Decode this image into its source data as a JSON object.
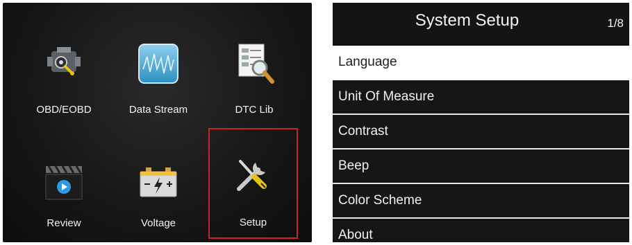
{
  "main_menu": {
    "items": [
      {
        "label": "OBD/EOBD",
        "icon": "engine-icon"
      },
      {
        "label": "Data Stream",
        "icon": "data-stream-icon"
      },
      {
        "label": "DTC Lib",
        "icon": "dtc-lib-icon"
      },
      {
        "label": "Review",
        "icon": "review-icon"
      },
      {
        "label": "Voltage",
        "icon": "battery-icon"
      },
      {
        "label": "Setup",
        "icon": "wrench-screwdriver-icon",
        "highlighted": true
      }
    ],
    "highlight_color": "#c4252f"
  },
  "system_setup": {
    "title": "System Setup",
    "page_indicator": "1/8",
    "items": [
      {
        "label": "Language",
        "selected": true
      },
      {
        "label": "Unit Of Measure"
      },
      {
        "label": "Contrast"
      },
      {
        "label": "Beep"
      },
      {
        "label": "Color Scheme"
      },
      {
        "label": "About"
      }
    ]
  }
}
